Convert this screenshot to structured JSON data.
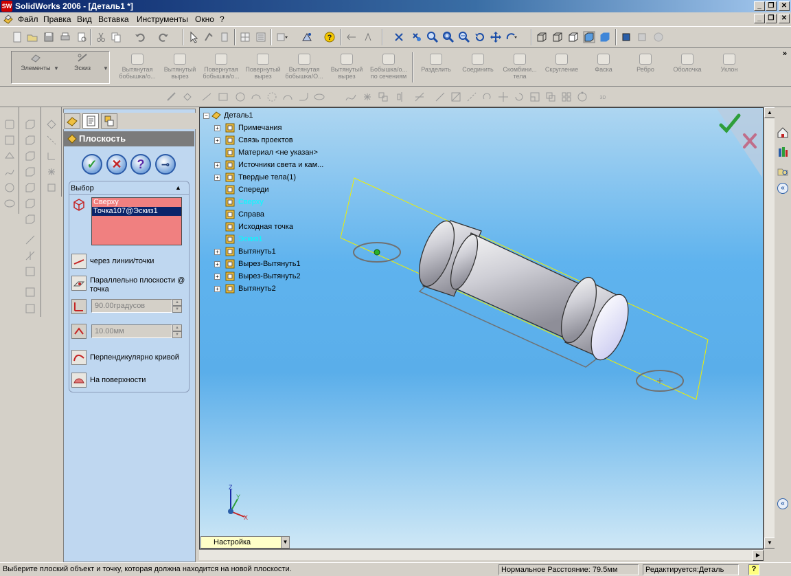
{
  "window": {
    "title": "SolidWorks 2006 - [Деталь1 *]",
    "app_icon_text": "SW",
    "minimize": "_",
    "restore": "❐",
    "close": "✕"
  },
  "menubar": {
    "items": [
      "Файл",
      "Правка",
      "Вид",
      "Вставка",
      "Инструменты",
      "Окно",
      "?"
    ]
  },
  "command_manager": {
    "groups": [
      "Элементы",
      "Эскиз"
    ],
    "commands": [
      "Вытянутая бобышка/о...",
      "Вытянутый вырез",
      "Повернутая бобышка/о...",
      "Повернутый вырез",
      "Вытянутая бобышка/О...",
      "Вытянутый вырез",
      "Бобышка/о... по сечениям",
      "Разделить",
      "Соединить",
      "Скомбини... тела",
      "Скругление",
      "Фаска",
      "Ребро",
      "Оболочка",
      "Уклон"
    ],
    "more": "»"
  },
  "property_manager": {
    "title": "Плоскость",
    "buttons": {
      "ok": "✓",
      "cancel": "✕",
      "help": "?",
      "pin": "⊸"
    },
    "selection": {
      "title": "Выбор",
      "items": [
        "Сверху",
        "Точка107@Эскиз1"
      ],
      "selected_index": 1
    },
    "options": {
      "through_lines_points": "через линии/точки",
      "parallel_plane_point": "Параллельно плоскости @ точка",
      "angle_value": "90.00градусов",
      "offset_value": "10.00мм",
      "normal_to_curve": "Перпендикулярно кривой",
      "on_surface": "На поверхности"
    }
  },
  "feature_tree": {
    "root": "Деталь1",
    "items": [
      {
        "label": "Примечания",
        "expandable": true
      },
      {
        "label": "Связь проектов",
        "expandable": true
      },
      {
        "label": "Материал <не указан>",
        "expandable": false
      },
      {
        "label": "Источники света и кам...",
        "expandable": true
      },
      {
        "label": "Твердые тела(1)",
        "expandable": true
      },
      {
        "label": "Спереди",
        "expandable": false
      },
      {
        "label": "Сверху",
        "expandable": false,
        "highlighted": true
      },
      {
        "label": "Справа",
        "expandable": false
      },
      {
        "label": "Исходная точка",
        "expandable": false
      },
      {
        "label": "Эскиз1",
        "expandable": false,
        "highlighted": true
      },
      {
        "label": "Вытянуть1",
        "expandable": true
      },
      {
        "label": "Вырез-Вытянуть1",
        "expandable": true
      },
      {
        "label": "Вырез-Вытянуть2",
        "expandable": true
      },
      {
        "label": "Вытянуть2",
        "expandable": true
      }
    ]
  },
  "configuration": {
    "selected": "Настройка"
  },
  "triad": {
    "x": "X",
    "y": "Y",
    "z": "Z"
  },
  "statusbar": {
    "message": "Выберите плоский объект и точку, которая должна находится на новой плоскости.",
    "distance": "Нормальное Расстояние: 79.5мм",
    "editing": "Редактируется:Деталь",
    "help": "?"
  },
  "colors": {
    "highlight_text": "#00ffff",
    "selection_bg": "#f08080",
    "selected_row": "#0a246a",
    "panel_bg": "#bfd7f0",
    "ok_green": "#2e9e3a",
    "cancel_red": "#c42424"
  }
}
